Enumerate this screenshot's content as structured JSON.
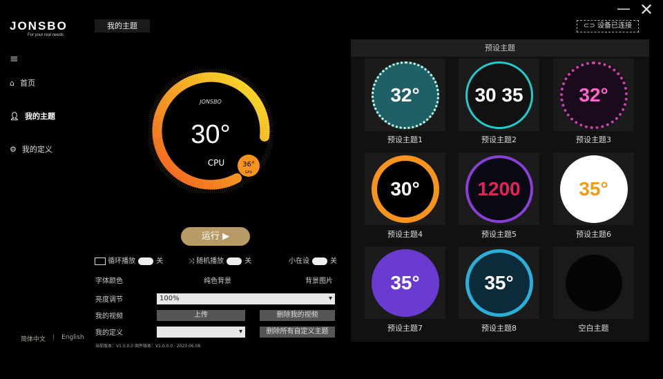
{
  "app": {
    "logo": "JONSBO",
    "logo_tagline": "For your real needs",
    "active_tab": "我的主题",
    "connection": "设备已连接"
  },
  "sidebar": {
    "items": [
      {
        "label": "首页",
        "icon": "home-icon"
      },
      {
        "label": "我的主题",
        "icon": "user-icon"
      },
      {
        "label": "我的定义",
        "icon": "gear-icon"
      }
    ]
  },
  "language": {
    "chinese": "简体中文",
    "english": "English"
  },
  "preview": {
    "brand": "JONSBO",
    "temp": "30°",
    "label": "CPU",
    "secondary_temp": "36°",
    "secondary_label": "GPU",
    "accent": "#f7941d"
  },
  "controls": {
    "run_label": "运行",
    "loop_play": "循环播放",
    "loop_state": "关",
    "shuffle_play": "随机播放",
    "shuffle_state": "关",
    "small_window": "小在设",
    "small_state": "关",
    "font_color": "字体颜色",
    "solid_bg": "纯色背景",
    "bg_image": "背景图片",
    "brightness_label": "亮度调节",
    "brightness_value": "100%",
    "my_video_label": "我的视频",
    "upload": "上传",
    "delete_video": "删除我的视频",
    "my_custom_label": "我的定义",
    "custom_value": "",
    "delete_custom": "删除所有自定义主题",
    "footer_info": "当前版本：V1.0.0.0    固件版本：V1.0.0.0 · 2023.06.08"
  },
  "themes": {
    "title": "预设主题",
    "items": [
      {
        "label": "预设主题1",
        "value": "32°",
        "bg": "#1f5f66"
      },
      {
        "label": "预设主题2",
        "value": "30 35",
        "bg": "#111"
      },
      {
        "label": "预设主题3",
        "value": "32°",
        "bg": "#1a0b1c"
      },
      {
        "label": "预设主题4",
        "value": "30°",
        "bg": "#000"
      },
      {
        "label": "预设主题5",
        "value": "1200",
        "bg": "#0a0a14"
      },
      {
        "label": "预设主题6",
        "value": "35°",
        "bg": "#fff"
      },
      {
        "label": "预设主题7",
        "value": "35°",
        "bg": "#6a3bd0"
      },
      {
        "label": "预设主题8",
        "value": "35°",
        "bg": "#0b2a3a"
      },
      {
        "label": "空白主题",
        "value": "",
        "bg": "#050505"
      }
    ]
  }
}
